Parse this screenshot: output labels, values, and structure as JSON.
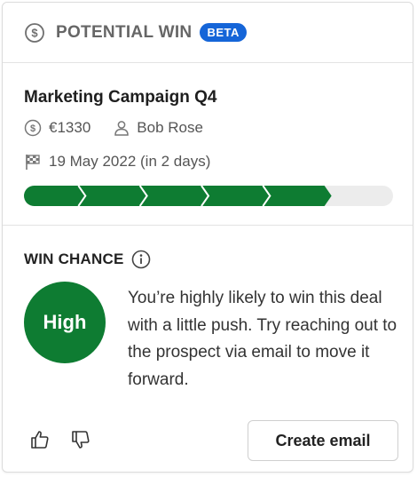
{
  "header": {
    "title": "POTENTIAL WIN",
    "badge": "BETA",
    "icon": "dollar-circle-icon"
  },
  "deal": {
    "name": "Marketing Campaign Q4",
    "amount": "€1330",
    "owner": "Bob Rose",
    "close_date": "19 May 2022 (in 2 days)",
    "icons": {
      "amount": "dollar-circle-icon",
      "owner": "user-icon",
      "close_date": "checkered-flag-icon"
    },
    "progress": {
      "completed_stages": 5,
      "total_stages": 6
    }
  },
  "win_chance": {
    "title": "WIN CHANCE",
    "level": "High",
    "advice": "You’re highly likely to win this deal with a little push. Try reaching out to the prospect via email to move it forward."
  },
  "actions": {
    "create_email_label": "Create email",
    "thumbs_up_icon": "thumbs-up-icon",
    "thumbs_down_icon": "thumbs-down-icon"
  },
  "colors": {
    "accent_green": "#0e7c32",
    "badge_blue": "#1565d8",
    "progress_track": "#ececec"
  }
}
